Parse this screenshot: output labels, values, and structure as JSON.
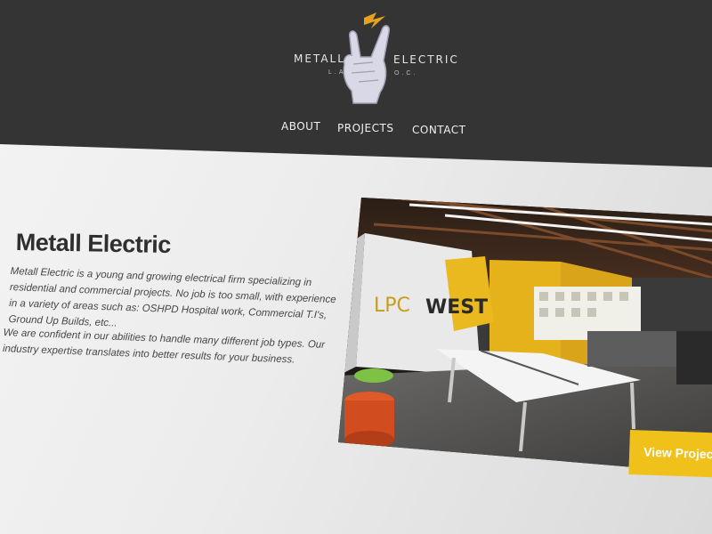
{
  "logo": {
    "left_word": "METALL",
    "right_word": "ELECTRIC",
    "sub_left": "L.A.",
    "sub_right": "O.C."
  },
  "nav": {
    "items": [
      {
        "label": "ABOUT"
      },
      {
        "label": "PROJECTS"
      },
      {
        "label": "CONTACT"
      }
    ]
  },
  "main": {
    "title": "Metall Electric",
    "paragraph1": "Metall Electric is a young and growing electrical firm specializing in residential and commercial projects. No job is too small, with experience in a variety of areas such as: OSHPD Hospital work, Commercial T.I's, Ground Up Builds, etc...",
    "paragraph2": "We are confident in our abilities to handle many different job types. Our industry expertise translates into better results for your business."
  },
  "hero": {
    "sign_text_left": "LPC",
    "sign_text_right": "WEST",
    "cta_label": "View Projects"
  },
  "colors": {
    "header_bg": "#343434",
    "accent": "#f0c11a",
    "logo_bolt": "#e8a31e",
    "text_dark": "#2f2f2f"
  }
}
